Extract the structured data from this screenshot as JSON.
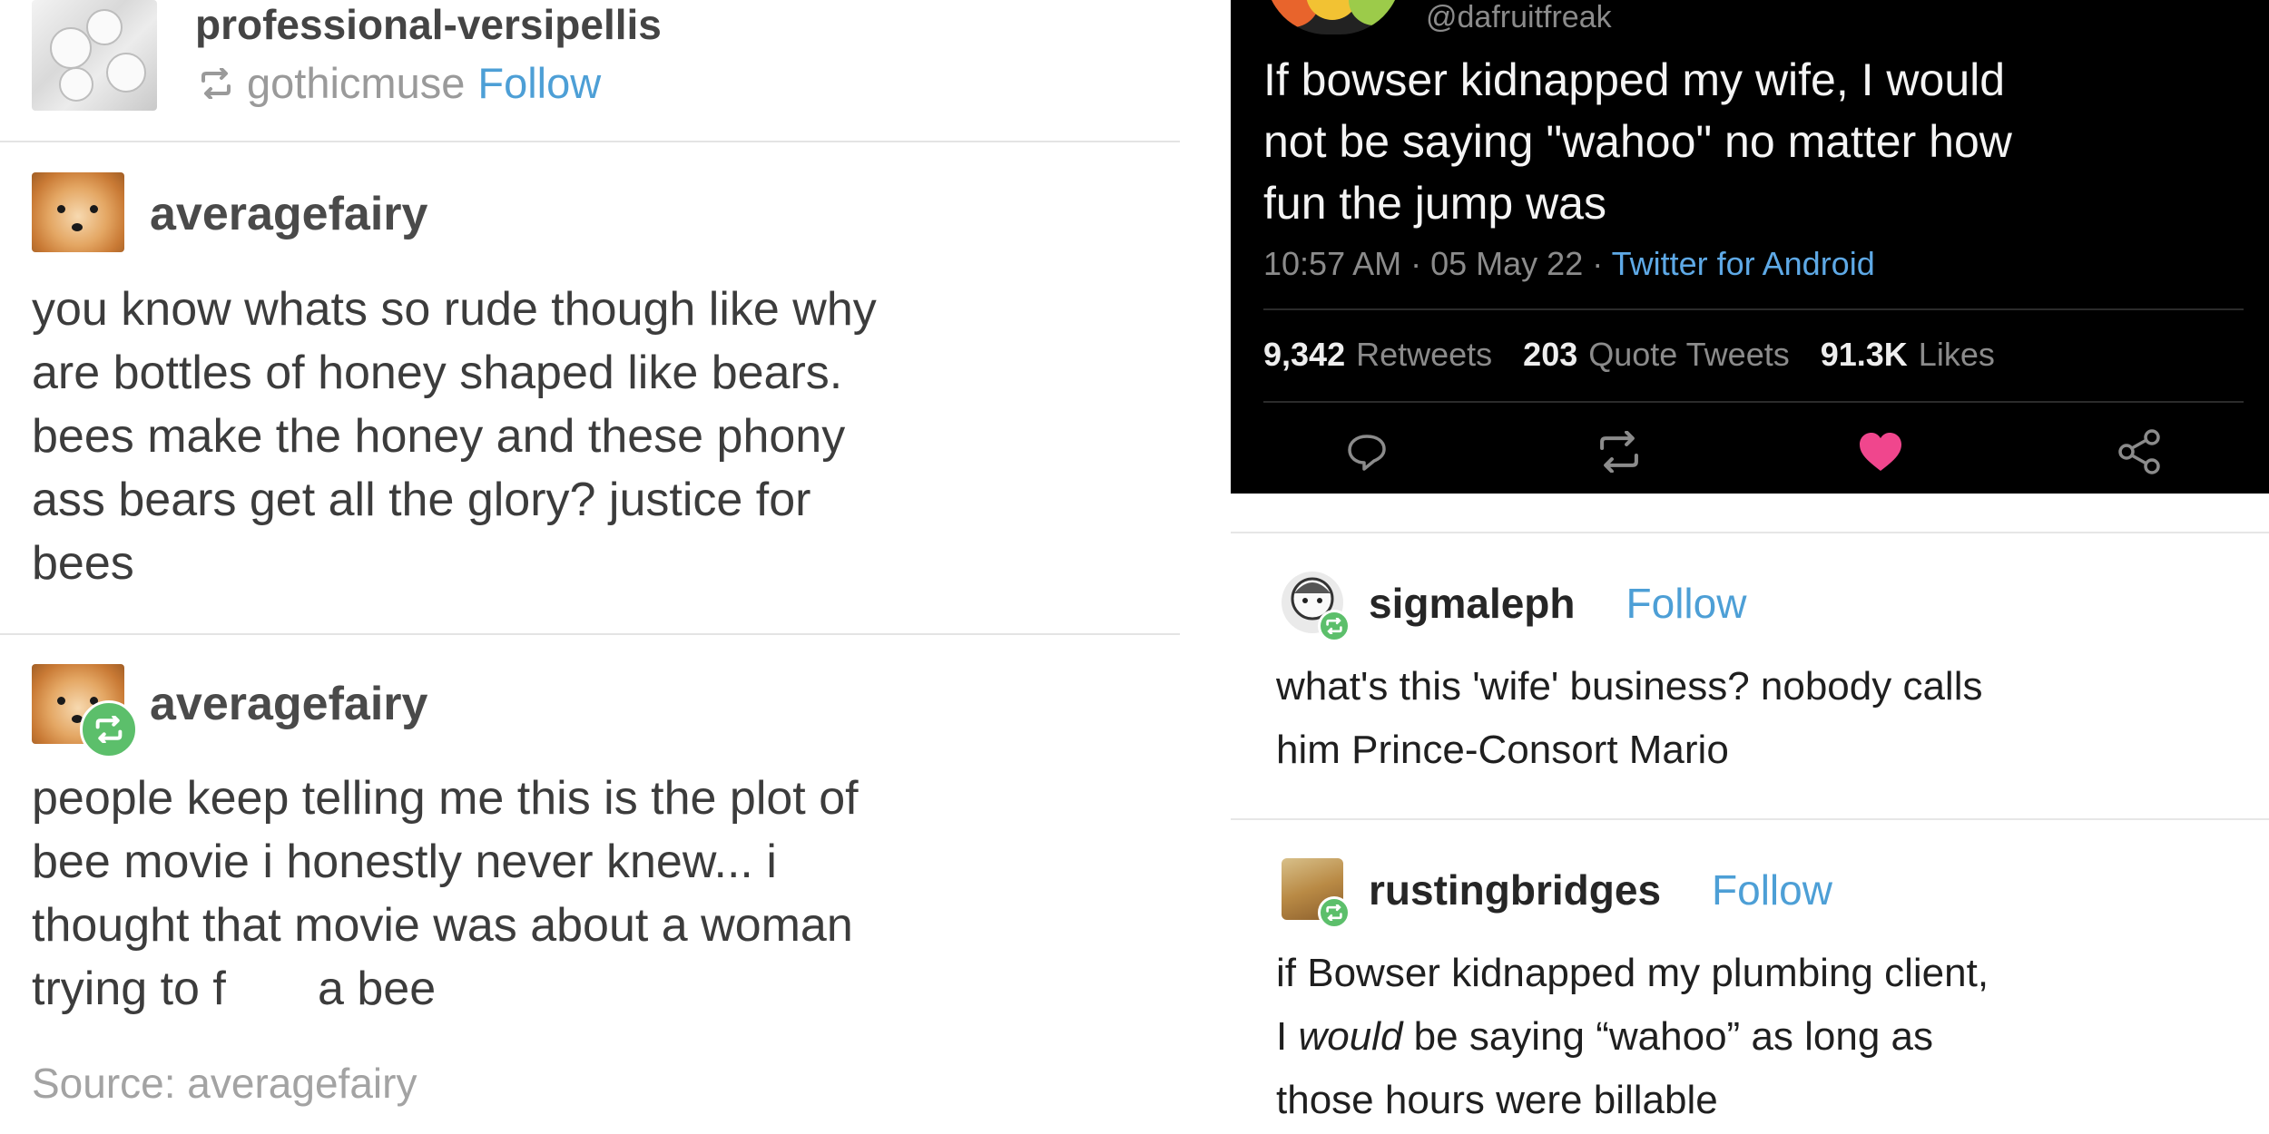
{
  "left_post": {
    "header": {
      "blog_name": "professional-versipellis",
      "reblogged_from": "gothicmuse",
      "follow_label": "Follow"
    },
    "entries": [
      {
        "username": "averagefairy",
        "lines": [
          "you know whats so rude though like why",
          "are bottles of honey shaped like bears.",
          "bees make the honey and these phony",
          "ass bears get all the glory? justice for",
          "bees"
        ]
      },
      {
        "username": "averagefairy",
        "lines": [
          "people keep telling me this is the plot of",
          "bee movie i honestly never knew... i",
          "thought that movie was about a woman",
          "trying to f       a bee"
        ]
      }
    ],
    "source_label": "Source: averagefairy"
  },
  "tweet": {
    "handle": "@dafruitfreak",
    "lines": [
      "If bowser kidnapped my wife, I would",
      "not be saying \"wahoo\" no matter how",
      "fun the jump was"
    ],
    "time": "10:57 AM",
    "date": "05 May 22",
    "source": "Twitter for Android",
    "retweets_count": "9,342",
    "retweets_label": "Retweets",
    "quotes_count": "203",
    "quotes_label": "Quote Tweets",
    "likes_count": "91.3K",
    "likes_label": "Likes",
    "like_color": "#f0468d",
    "icons": [
      "reply-icon",
      "retweet-icon",
      "heart-icon",
      "share-icon"
    ]
  },
  "replies": [
    {
      "username": "sigmaleph",
      "follow_label": "Follow",
      "lines": [
        "what's this 'wife' business? nobody calls",
        "him Prince-Consort Mario"
      ]
    },
    {
      "username": "rustingbridges",
      "follow_label": "Follow",
      "lines": [
        "if Bowser kidnapped my plumbing client,",
        "I",
        "would",
        "be saying “wahoo” as long as",
        "those hours were billable"
      ]
    }
  ],
  "colors": {
    "follow_blue": "#4d9fd6",
    "reblog_green": "#5cbf6b",
    "tweet_bg": "#000000",
    "twitter_link": "#5ea9e6"
  }
}
